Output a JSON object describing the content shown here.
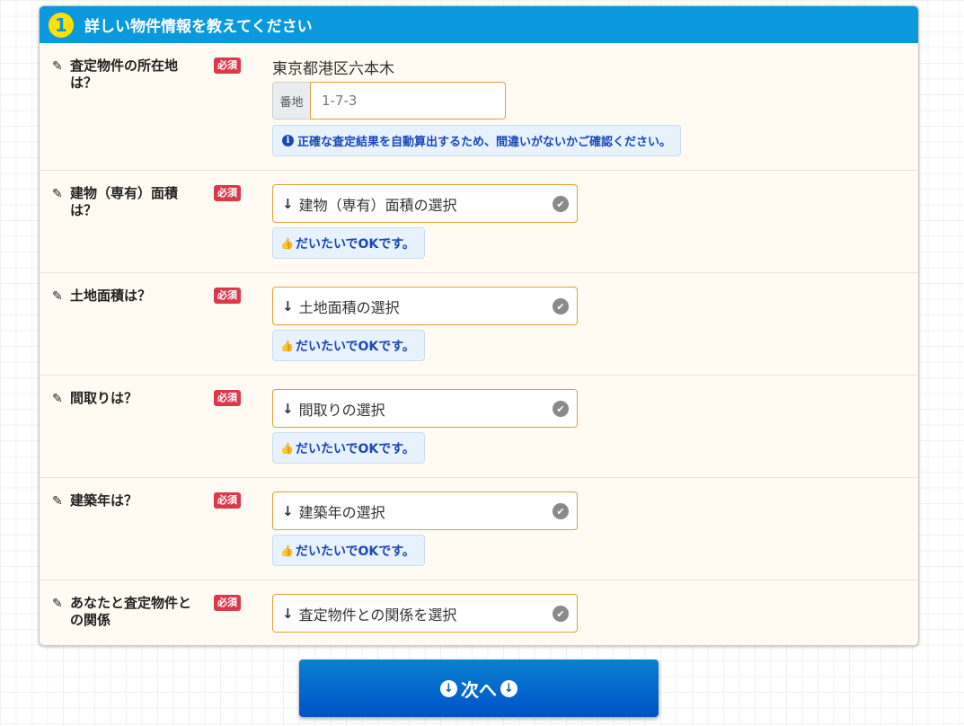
{
  "section": {
    "step_number": "1",
    "title": "詳しい物件情報を教えてください"
  },
  "required_badge": "必須",
  "rows": [
    {
      "label_line1": "査定物件の所在地",
      "label_line2": "は？",
      "address": "東京都港区六本木",
      "addon_label": "番地",
      "banchi_value": "1-7-3",
      "info_text": "正確な査定結果を自動算出するため、間違いがないかご確認ください。"
    },
    {
      "label_line1": "建物（専有）面積",
      "label_line2": "は？",
      "select_label": "建物（専有）面積の選択",
      "hint": "だいたいでOKです。"
    },
    {
      "label_line1": "土地面積は？",
      "label_line2": "",
      "select_label": "土地面積の選択",
      "hint": "だいたいでOKです。"
    },
    {
      "label_line1": "間取りは？",
      "label_line2": "",
      "select_label": "間取りの選択",
      "hint": "だいたいでOKです。"
    },
    {
      "label_line1": "建築年は？",
      "label_line2": "",
      "select_label": "建築年の選択",
      "hint": "だいたいでOKです。"
    },
    {
      "label_line1": "あなたと査定物件と",
      "label_line2": "の関係",
      "select_label": "査定物件との関係を選択"
    }
  ],
  "next_button": {
    "label": "次へ"
  },
  "icons": {
    "pencil": "✎",
    "arrow_down": "↓",
    "check": "✔",
    "info": "i",
    "thumbs_up": "👍"
  },
  "colors": {
    "header": "#0a99dc",
    "step_circle": "#ffe100",
    "required": "#d9394b",
    "select_border": "#e39d3a",
    "hint_text": "#1a47b8",
    "button": "#0050c8"
  }
}
